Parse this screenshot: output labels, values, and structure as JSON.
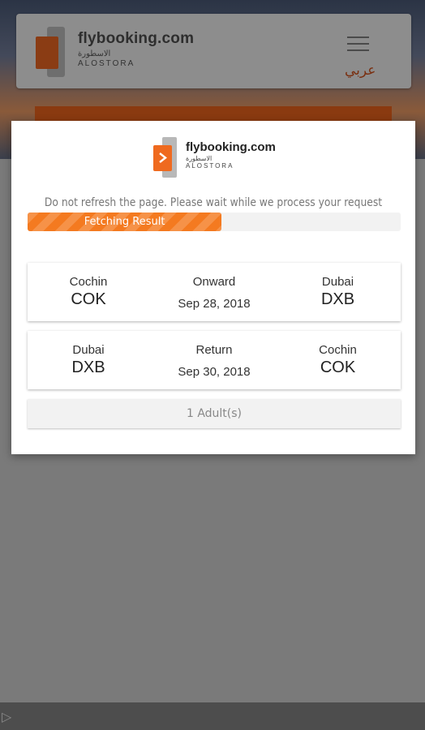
{
  "background": {
    "brand_name": "flybooking.com",
    "brand_arabic": "الاسطورة",
    "brand_sub": "ALOSTORA",
    "language_link": "عربي"
  },
  "modal": {
    "logo": {
      "name": "flybooking.com",
      "arabic": "الاسطورة",
      "sub": "ALOSTORA"
    },
    "wait_message": "Do not refresh the page. Please wait while we process your request",
    "progress": {
      "label": "Fetching Result",
      "percent": 52
    },
    "onward": {
      "from_city": "Cochin",
      "from_code": "COK",
      "direction": "Onward",
      "date": "Sep 28, 2018",
      "to_city": "Dubai",
      "to_code": "DXB"
    },
    "return": {
      "from_city": "Dubai",
      "from_code": "DXB",
      "direction": "Return",
      "date": "Sep 30, 2018",
      "to_city": "Cochin",
      "to_code": "COK"
    },
    "passengers": "1 Adult(s)"
  },
  "colors": {
    "accent": "#f47a20",
    "overlay": "#7a7a7a"
  }
}
